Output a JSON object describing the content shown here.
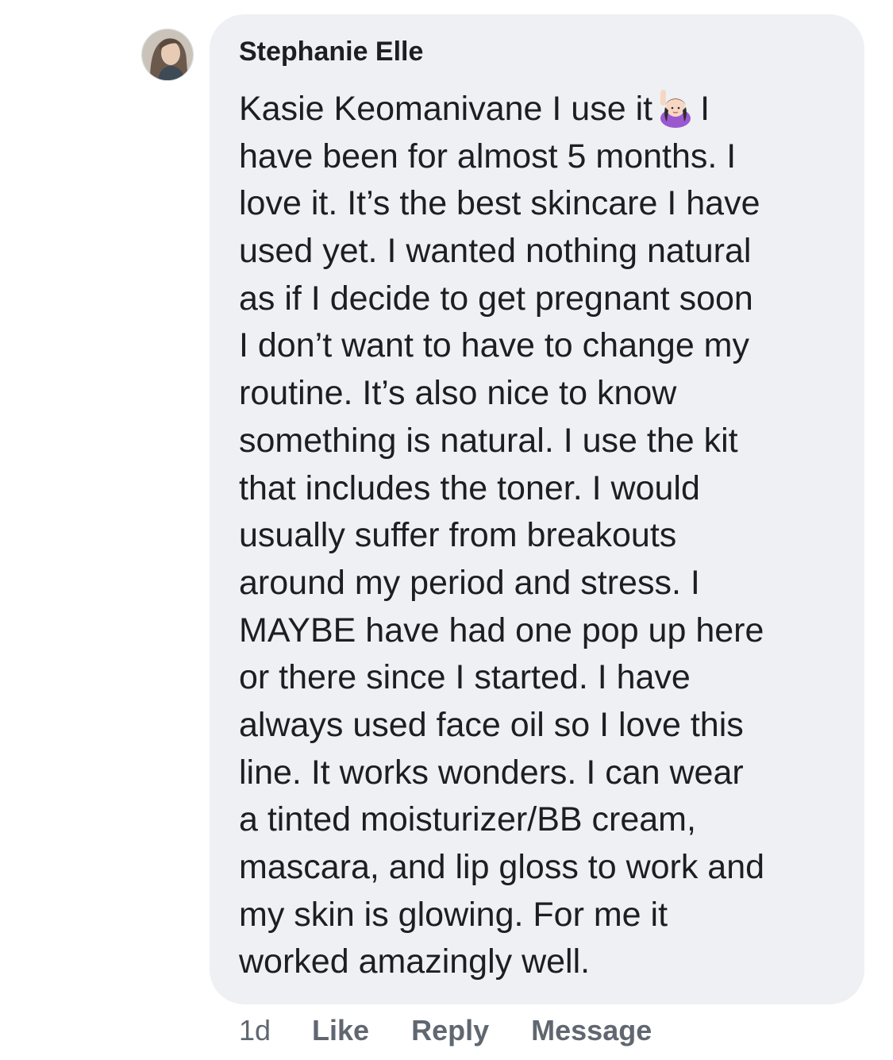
{
  "comment": {
    "author": "Stephanie Elle",
    "avatar_icon": "user-avatar",
    "emoji_icon": "raising-hand-woman-emoji",
    "body_lines": [
      {
        "before": "Kasie Keomanivane I use it",
        "after": "I"
      },
      "have been for  almost 5 months. I",
      "love it. It’s the best skincare I have",
      "used yet. I wanted nothing natural",
      "as if I decide to get pregnant soon",
      "I don’t want to have to change my",
      "routine. It’s also nice to know",
      "something is natural. I use the kit",
      "that includes the toner. I would",
      "usually suffer from breakouts",
      "around my period and stress. I",
      "MAYBE have had one pop up here",
      "or there since I started. I have",
      "always used face oil so I love this",
      "line. It works wonders. I can wear",
      "a tinted moisturizer/BB cream,",
      "mascara, and lip gloss to work and",
      "my skin is glowing. For me it",
      "worked amazingly well."
    ],
    "timestamp": "1d",
    "actions": {
      "like": "Like",
      "reply": "Reply",
      "message": "Message"
    }
  },
  "colors": {
    "bubble_background": "#eff0f3",
    "text": "#1c1e21",
    "secondary_text": "#606770"
  }
}
